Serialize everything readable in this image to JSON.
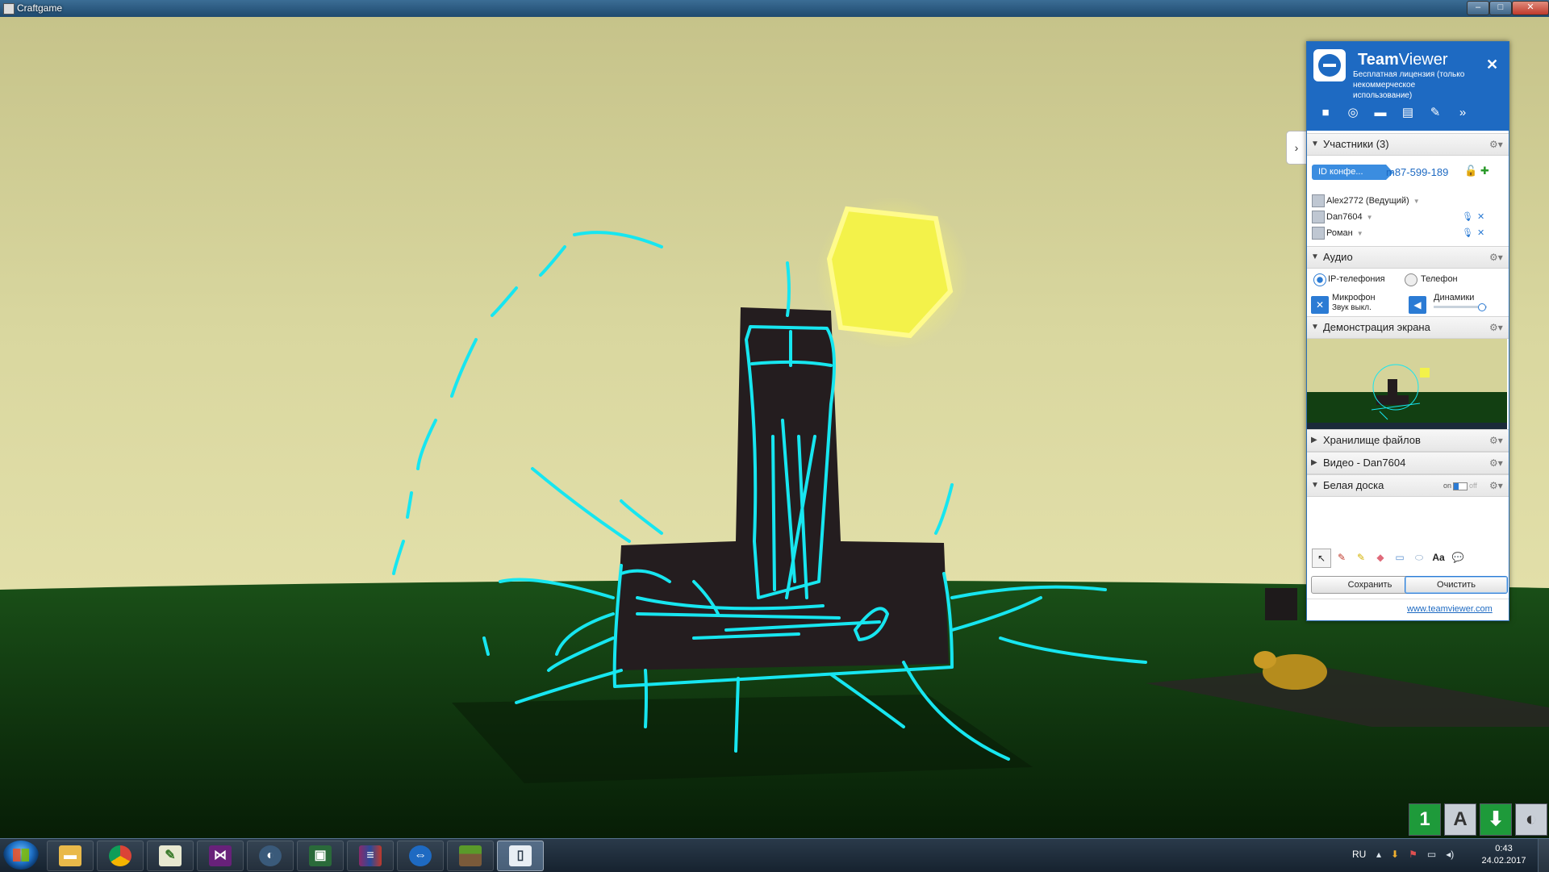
{
  "window": {
    "title": "Craftgame",
    "min": "–",
    "max": "□",
    "close": "✕"
  },
  "teamviewer": {
    "brand_bold": "Team",
    "brand_light": "Viewer",
    "license": "Бесплатная лицензия (только некоммерческое использование)",
    "close": "✕",
    "collapse": "›",
    "toolbar_icons": [
      "video-icon",
      "headset-icon",
      "chat-icon",
      "files-icon",
      "draw-icon",
      "more-icon"
    ],
    "participants_header": "Участники (3)",
    "conference_id_label": "ID конфе...",
    "conference_id_value": "m87-599-189",
    "participants": [
      {
        "name": "Alex2772 (Ведущий)"
      },
      {
        "name": "Dan7604"
      },
      {
        "name": "Роман"
      }
    ],
    "audio_header": "Аудио",
    "ip_telephony": "IP-телефония",
    "phone": "Телефон",
    "microphone": "Микрофон",
    "mic_status": "Звук выкл.",
    "speakers": "Динамики",
    "speaker_volume": 0.9,
    "screen_demo_header": "Демонстрация экрана",
    "file_storage_header": "Хранилище файлов",
    "video_header": "Видео - Dan7604",
    "whiteboard_header": "Белая доска",
    "on_label": "on",
    "off_label": "off",
    "text_tool_label": "Aa",
    "save_button": "Сохранить",
    "clear_button": "Очистить",
    "link": "www.teamviewer.com"
  },
  "taskbar": {
    "apps": [
      "file-explorer",
      "chrome",
      "notepad-plus-plus",
      "visual-studio",
      "media-app",
      "terminal-app",
      "winrar",
      "teamviewer",
      "minecraft",
      "craftgame"
    ],
    "language": "RU",
    "time": "0:43",
    "date": "24.02.2017"
  },
  "colors": {
    "teamviewer_blue": "#1e6ac2",
    "annotation_cyan": "#17e6f0",
    "sky": "#d8d69b",
    "ground": "#0f3a10"
  }
}
